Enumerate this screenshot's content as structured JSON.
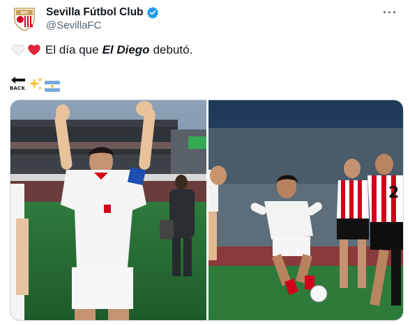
{
  "account": {
    "display_name": "Sevilla Fútbol Club",
    "handle": "@SevillaFC",
    "verified_icon": "verified-badge-icon",
    "avatar_icon": "sevilla-crest-icon"
  },
  "menu": {
    "icon": "more-options-icon"
  },
  "tweet": {
    "text_before": "El día que",
    "text_emphasis": "El Diego",
    "text_after": "debutó.",
    "emojis": [
      "white-heart-icon",
      "red-heart-icon"
    ]
  },
  "emoji_row": {
    "back_label": "BACK",
    "icons": [
      "back-arrow-icon",
      "sparkles-icon",
      "argentina-flag-icon"
    ]
  },
  "media": {
    "photos": [
      {
        "name": "maradona-waving-photo"
      },
      {
        "name": "maradona-dribbling-photo"
      }
    ]
  },
  "colors": {
    "text": "#0f1419",
    "secondary": "#536471",
    "verified": "#1d9bf0",
    "border": "#cfd9de",
    "sevilla_red": "#d0021b"
  }
}
